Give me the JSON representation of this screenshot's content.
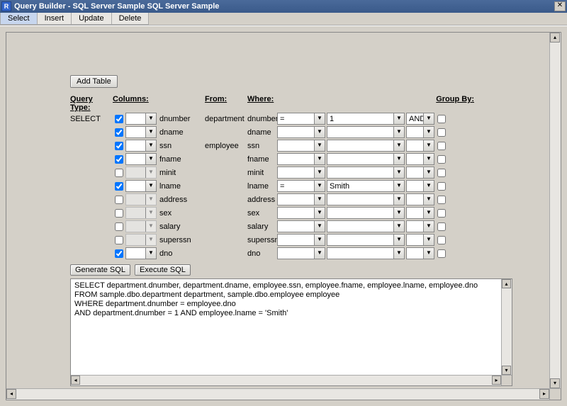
{
  "window": {
    "title": "Query Builder - SQL Server Sample SQL Server Sample"
  },
  "menu": {
    "select": "Select",
    "insert": "Insert",
    "update": "Update",
    "delete": "Delete"
  },
  "buttons": {
    "add_table": "Add Table",
    "generate_sql": "Generate SQL",
    "execute_sql": "Execute SQL"
  },
  "headers": {
    "query_type": "Query Type:",
    "columns": "Columns:",
    "from": "From:",
    "where": "Where:",
    "group_by": "Group By:"
  },
  "query_type": "SELECT",
  "rows": [
    {
      "checked": true,
      "enabled": true,
      "col": "dnumber",
      "from": "department",
      "wherecol": "dnumber",
      "op": "=",
      "val": "1",
      "and": "AND"
    },
    {
      "checked": true,
      "enabled": true,
      "col": "dname",
      "from": "",
      "wherecol": "dname",
      "op": "",
      "val": "",
      "and": ""
    },
    {
      "checked": true,
      "enabled": true,
      "col": "ssn",
      "from": "employee",
      "wherecol": "ssn",
      "op": "",
      "val": "",
      "and": ""
    },
    {
      "checked": true,
      "enabled": true,
      "col": "fname",
      "from": "",
      "wherecol": "fname",
      "op": "",
      "val": "",
      "and": ""
    },
    {
      "checked": false,
      "enabled": false,
      "col": "minit",
      "from": "",
      "wherecol": "minit",
      "op": "",
      "val": "",
      "and": ""
    },
    {
      "checked": true,
      "enabled": true,
      "col": "lname",
      "from": "",
      "wherecol": "lname",
      "op": "=",
      "val": "Smith",
      "and": ""
    },
    {
      "checked": false,
      "enabled": false,
      "col": "address",
      "from": "",
      "wherecol": "address",
      "op": "",
      "val": "",
      "and": ""
    },
    {
      "checked": false,
      "enabled": false,
      "col": "sex",
      "from": "",
      "wherecol": "sex",
      "op": "",
      "val": "",
      "and": ""
    },
    {
      "checked": false,
      "enabled": false,
      "col": "salary",
      "from": "",
      "wherecol": "salary",
      "op": "",
      "val": "",
      "and": ""
    },
    {
      "checked": false,
      "enabled": false,
      "col": "superssn",
      "from": "",
      "wherecol": "superssn",
      "op": "",
      "val": "",
      "and": ""
    },
    {
      "checked": true,
      "enabled": true,
      "col": "dno",
      "from": "",
      "wherecol": "dno",
      "op": "",
      "val": "",
      "and": ""
    }
  ],
  "sql": "SELECT department.dnumber, department.dname, employee.ssn, employee.fname, employee.lname, employee.dno\nFROM sample.dbo.department department, sample.dbo.employee employee\nWHERE department.dnumber = employee.dno\nAND department.dnumber = 1 AND employee.lname = 'Smith'"
}
